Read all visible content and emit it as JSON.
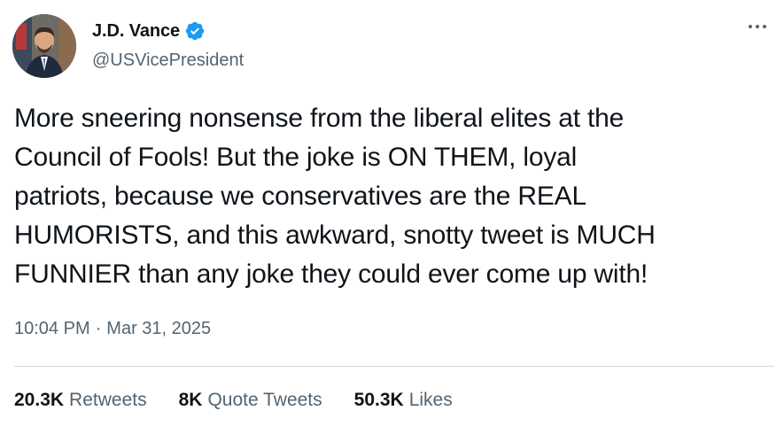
{
  "author": {
    "display_name": "J.D. Vance",
    "handle": "@USVicePresident",
    "verified": true
  },
  "tweet": {
    "text": "More sneering nonsense from the liberal elites at the\nCouncil of Fools! But the joke is ON THEM, loyal\npatriots, because we conservatives are the REAL\nHUMORISTS, and this awkward, snotty tweet is MUCH\nFUNNIER than any joke they could ever come up with!",
    "time": "10:04 PM",
    "separator": "·",
    "date": "Mar 31, 2025"
  },
  "stats": [
    {
      "count": "20.3K",
      "label": "Retweets"
    },
    {
      "count": "8K",
      "label": "Quote Tweets"
    },
    {
      "count": "50.3K",
      "label": "Likes"
    }
  ],
  "icons": {
    "verified": "verified-badge-icon",
    "more": "more-horizontal-icon"
  },
  "colors": {
    "verified_blue": "#1d9bf0",
    "text_primary": "#0f1419",
    "text_secondary": "#536471",
    "divider": "#cfd9de"
  }
}
